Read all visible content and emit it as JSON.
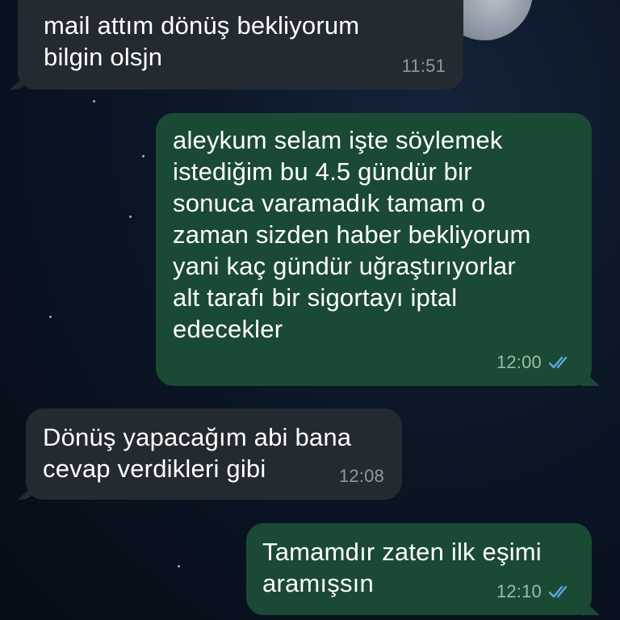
{
  "messages": [
    {
      "direction": "incoming",
      "text": "mail attım dönüş bekliyorum\nbilgin olsjn",
      "time": "11:51"
    },
    {
      "direction": "outgoing",
      "text": "aleykum selam işte söylemek\nistediğim bu 4.5 gündür bir\nsonuca varamadık tamam o\nzaman sizden haber bekliyorum\nyani kaç gündür uğraştırıyorlar\nalt tarafı bir sigortayı iptal\nedecekler",
      "time": "12:00",
      "status": "read-double-check"
    },
    {
      "direction": "incoming",
      "text": "Dönüş yapacağım abi bana\ncevap verdikleri gibi",
      "time": "12:08"
    },
    {
      "direction": "outgoing",
      "text": "Tamamdır zaten ilk eşimi\naramışsın",
      "time": "12:10",
      "status": "read-double-check"
    }
  ],
  "colors": {
    "incoming_bubble": "#232a31",
    "outgoing_bubble": "#1b4a34",
    "read_ticks": "#5aa9e6",
    "background": "#0b1626"
  }
}
